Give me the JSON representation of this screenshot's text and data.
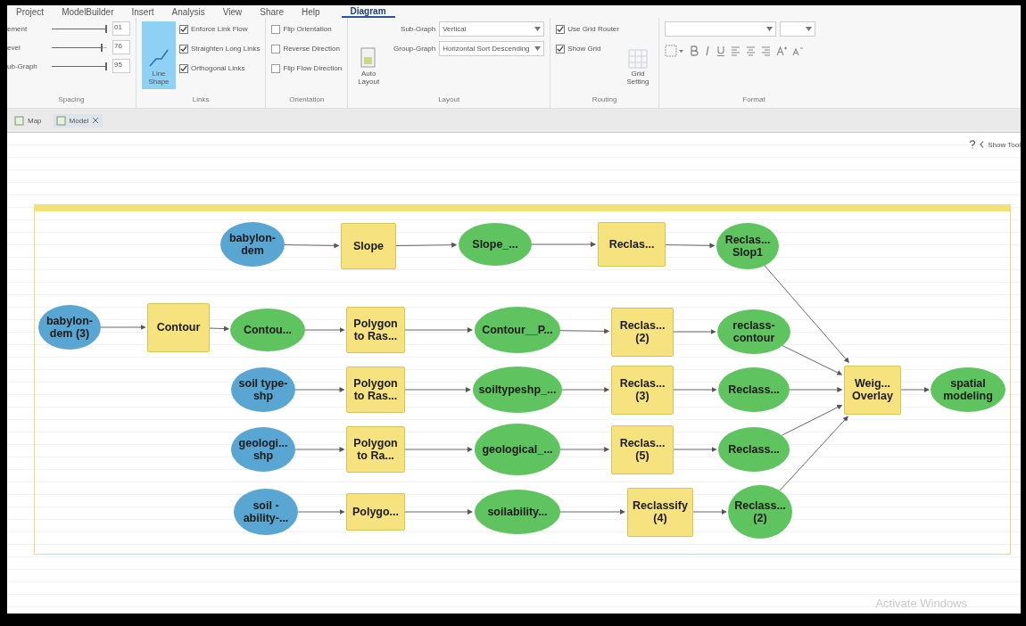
{
  "ribbon_tabs": [
    {
      "label": "Project",
      "selected": false
    },
    {
      "label": "ModelBuilder",
      "selected": false
    },
    {
      "label": "Insert",
      "selected": false
    },
    {
      "label": "Analysis",
      "selected": false
    },
    {
      "label": "View",
      "selected": false
    },
    {
      "label": "Share",
      "selected": false
    },
    {
      "label": "Help",
      "selected": false
    },
    {
      "label": "Diagram",
      "selected": true
    }
  ],
  "spacing": {
    "label": "Spacing",
    "sliders": [
      {
        "name": "ement",
        "level": 1.0,
        "value": "01"
      },
      {
        "name": "evel",
        "level": 0.92,
        "value": "76"
      },
      {
        "name": "ub-Graph",
        "level": 1.0,
        "value": "95"
      }
    ]
  },
  "links": {
    "label": "Links",
    "button": {
      "label": "Line Shape",
      "selected": true
    },
    "options": [
      {
        "label": "Enforce Link Flow",
        "checked": true
      },
      {
        "label": "Straighten Long Links",
        "checked": true
      },
      {
        "label": "Orthogonal Links",
        "checked": true
      }
    ]
  },
  "orientation": {
    "label": "Orientation",
    "options": [
      {
        "label": "Flip Orientation",
        "checked": false
      },
      {
        "label": "Reverse Direction",
        "checked": false
      },
      {
        "label": "Flip Flow Direction",
        "checked": false
      }
    ]
  },
  "layout": {
    "label": "Layout",
    "button": "Auto Layout",
    "fields": [
      {
        "label": "Sub-Graph",
        "value": "Vertical"
      },
      {
        "label": "Group-Graph",
        "value": "Horizontal Sort Descending"
      }
    ]
  },
  "routing": {
    "label": "Routing",
    "options": [
      {
        "label": "Use Grid Router",
        "checked": true
      },
      {
        "label": "Show Grid",
        "checked": true
      }
    ],
    "button": "Grid Setting"
  },
  "format": {
    "label": "Format"
  },
  "doc_tabs": [
    {
      "label": "Map",
      "selected": false,
      "closable": false
    },
    {
      "label": "Model",
      "selected": true,
      "closable": true
    }
  ],
  "show_tools": "Show Tool",
  "model": {
    "chains": [
      [
        {
          "label": "babylon-dem",
          "kind": "input"
        },
        {
          "label": "Slope",
          "kind": "tool"
        },
        {
          "label": "Slope_...",
          "kind": "output"
        },
        {
          "label": "Reclas...",
          "kind": "tool"
        },
        {
          "label": "Reclas... Slop1",
          "kind": "output"
        }
      ],
      [
        {
          "label": "babylon-dem (3)",
          "kind": "input"
        },
        {
          "label": "Contour",
          "kind": "tool"
        },
        {
          "label": "Contou...",
          "kind": "output"
        },
        {
          "label": "Polygon to Ras...",
          "kind": "tool"
        },
        {
          "label": "Contour__P...",
          "kind": "output"
        },
        {
          "label": "Reclas... (2)",
          "kind": "tool"
        },
        {
          "label": "reclass-contour",
          "kind": "output"
        }
      ],
      [
        {
          "label": "soil type-shp",
          "kind": "input"
        },
        {
          "label": "Polygon to Ras...",
          "kind": "tool"
        },
        {
          "label": "soiltypeshp_...",
          "kind": "output"
        },
        {
          "label": "Reclas... (3)",
          "kind": "tool"
        },
        {
          "label": "Reclass...",
          "kind": "output"
        }
      ],
      [
        {
          "label": "geologi... shp",
          "kind": "input"
        },
        {
          "label": "Polygon to Ra...",
          "kind": "tool"
        },
        {
          "label": "geological_...",
          "kind": "output"
        },
        {
          "label": "Reclas... (5)",
          "kind": "tool"
        },
        {
          "label": "Reclass...",
          "kind": "output"
        }
      ],
      [
        {
          "label": "soil - ability-...",
          "kind": "input"
        },
        {
          "label": "Polygo...",
          "kind": "tool"
        },
        {
          "label": "soilability...",
          "kind": "output"
        },
        {
          "label": "Reclassify (4)",
          "kind": "tool"
        },
        {
          "label": "Reclass... (2)",
          "kind": "output"
        }
      ]
    ],
    "overlay": {
      "label": "Weig... Overlay",
      "kind": "tool"
    },
    "result": {
      "label": "spatial modeling",
      "kind": "output"
    }
  },
  "os_notice": "Activate Windows"
}
